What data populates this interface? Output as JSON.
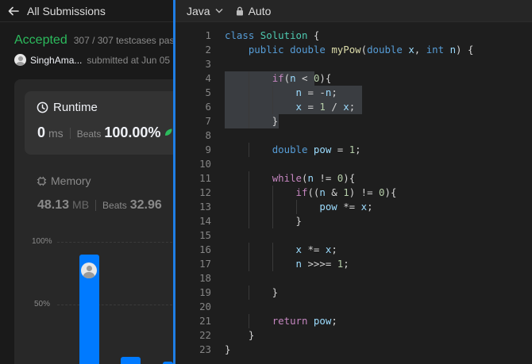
{
  "left_panel": {
    "header": {
      "title": "All Submissions"
    },
    "status": "Accepted",
    "testcases": "307 / 307 testcases pas",
    "user": "SinghAma...",
    "submitted": "submitted at Jun 05",
    "runtime": {
      "title": "Runtime",
      "value": "0",
      "unit": "ms",
      "beats_label": "Beats",
      "beats_value": "100.00%"
    },
    "memory": {
      "title": "Memory",
      "value": "48.13",
      "unit": "MB",
      "beats_label": "Beats",
      "beats_value": "32.96"
    },
    "chart_data": {
      "type": "bar",
      "title": "",
      "xlabel": "",
      "ylabel": "",
      "yticks": [
        "100%",
        "50%"
      ],
      "ylim": [
        0,
        100
      ],
      "values": [
        100,
        3,
        1
      ],
      "colors": {
        "bar": "#007aff"
      }
    }
  },
  "editor": {
    "language": "Java",
    "mode": "Auto",
    "lines": [
      [
        [
          "class",
          "ty"
        ],
        [
          " "
        ],
        [
          "Solution",
          "cls"
        ],
        [
          " {"
        ]
      ],
      [
        [
          "    "
        ],
        [
          "public",
          "ty"
        ],
        [
          " "
        ],
        [
          "double",
          "ty"
        ],
        [
          " "
        ],
        [
          "myPow",
          "fn"
        ],
        [
          "("
        ],
        [
          "double",
          "ty"
        ],
        [
          " "
        ],
        [
          "x",
          "var"
        ],
        [
          ", "
        ],
        [
          "int",
          "ty"
        ],
        [
          " "
        ],
        [
          "n",
          "var"
        ],
        [
          ") {"
        ]
      ],
      [
        [
          ""
        ]
      ],
      [
        [
          "        "
        ],
        [
          "if",
          "kw"
        ],
        [
          "("
        ],
        [
          "n",
          "var"
        ],
        [
          " < "
        ],
        [
          "0",
          "num"
        ],
        [
          "){"
        ]
      ],
      [
        [
          "            "
        ],
        [
          "n",
          "var"
        ],
        [
          " = -"
        ],
        [
          "n",
          "var"
        ],
        [
          ";"
        ]
      ],
      [
        [
          "            "
        ],
        [
          "x",
          "var"
        ],
        [
          " = "
        ],
        [
          "1",
          "num"
        ],
        [
          " / "
        ],
        [
          "x",
          "var"
        ],
        [
          ";"
        ]
      ],
      [
        [
          "        }"
        ]
      ],
      [
        [
          ""
        ]
      ],
      [
        [
          "        "
        ],
        [
          "double",
          "ty"
        ],
        [
          " "
        ],
        [
          "pow",
          "var"
        ],
        [
          " = "
        ],
        [
          "1",
          "num"
        ],
        [
          ";"
        ]
      ],
      [
        [
          ""
        ]
      ],
      [
        [
          "        "
        ],
        [
          "while",
          "kw"
        ],
        [
          "("
        ],
        [
          "n",
          "var"
        ],
        [
          " != "
        ],
        [
          "0",
          "num"
        ],
        [
          "){"
        ]
      ],
      [
        [
          "            "
        ],
        [
          "if",
          "kw"
        ],
        [
          "(("
        ],
        [
          "n",
          "var"
        ],
        [
          " & "
        ],
        [
          "1",
          "num"
        ],
        [
          ") != "
        ],
        [
          "0",
          "num"
        ],
        [
          "){"
        ]
      ],
      [
        [
          "                "
        ],
        [
          "pow",
          "var"
        ],
        [
          " *= "
        ],
        [
          "x",
          "var"
        ],
        [
          ";"
        ]
      ],
      [
        [
          "            }"
        ]
      ],
      [
        [
          ""
        ]
      ],
      [
        [
          "            "
        ],
        [
          "x",
          "var"
        ],
        [
          " *= "
        ],
        [
          "x",
          "var"
        ],
        [
          ";"
        ]
      ],
      [
        [
          "            "
        ],
        [
          "n",
          "var"
        ],
        [
          " >>>= "
        ],
        [
          "1",
          "num"
        ],
        [
          ";"
        ]
      ],
      [
        [
          ""
        ]
      ],
      [
        [
          "        }"
        ]
      ],
      [
        [
          ""
        ]
      ],
      [
        [
          "        "
        ],
        [
          "return",
          "kw"
        ],
        [
          " "
        ],
        [
          "pow",
          "var"
        ],
        [
          ";"
        ]
      ],
      [
        [
          "    }"
        ]
      ],
      [
        [
          "}"
        ]
      ]
    ]
  }
}
